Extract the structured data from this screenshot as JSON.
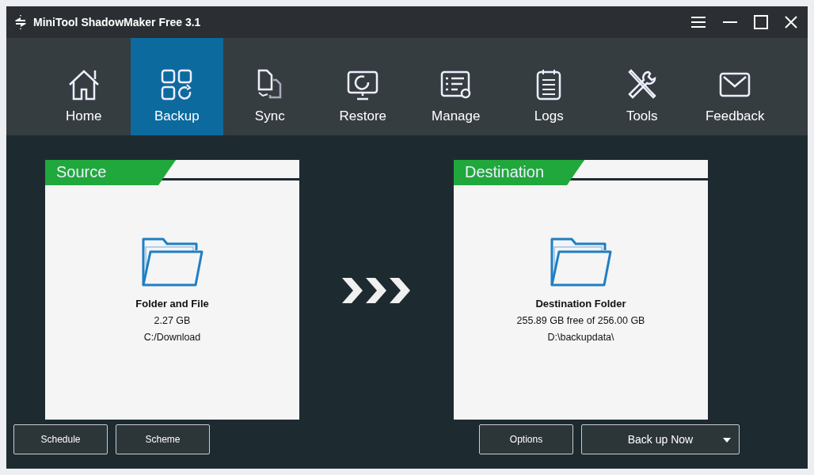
{
  "window": {
    "title": "MiniTool ShadowMaker Free 3.1"
  },
  "nav": [
    {
      "label": "Home",
      "selected": false
    },
    {
      "label": "Backup",
      "selected": true
    },
    {
      "label": "Sync",
      "selected": false
    },
    {
      "label": "Restore",
      "selected": false
    },
    {
      "label": "Manage",
      "selected": false
    },
    {
      "label": "Logs",
      "selected": false
    },
    {
      "label": "Tools",
      "selected": false
    },
    {
      "label": "Feedback",
      "selected": false
    }
  ],
  "panels": [
    {
      "header": "Source",
      "title": "Folder and File",
      "size": "2.27 GB",
      "path": "C:/Download"
    },
    {
      "header": "Destination",
      "title": "Destination Folder",
      "size": "255.89 GB free of 256.00 GB",
      "path": "D:\\backupdata\\"
    }
  ],
  "left_buttons": [
    "Schedule",
    "Scheme"
  ],
  "options_button": "Options",
  "backup_button": "Back up Now"
}
